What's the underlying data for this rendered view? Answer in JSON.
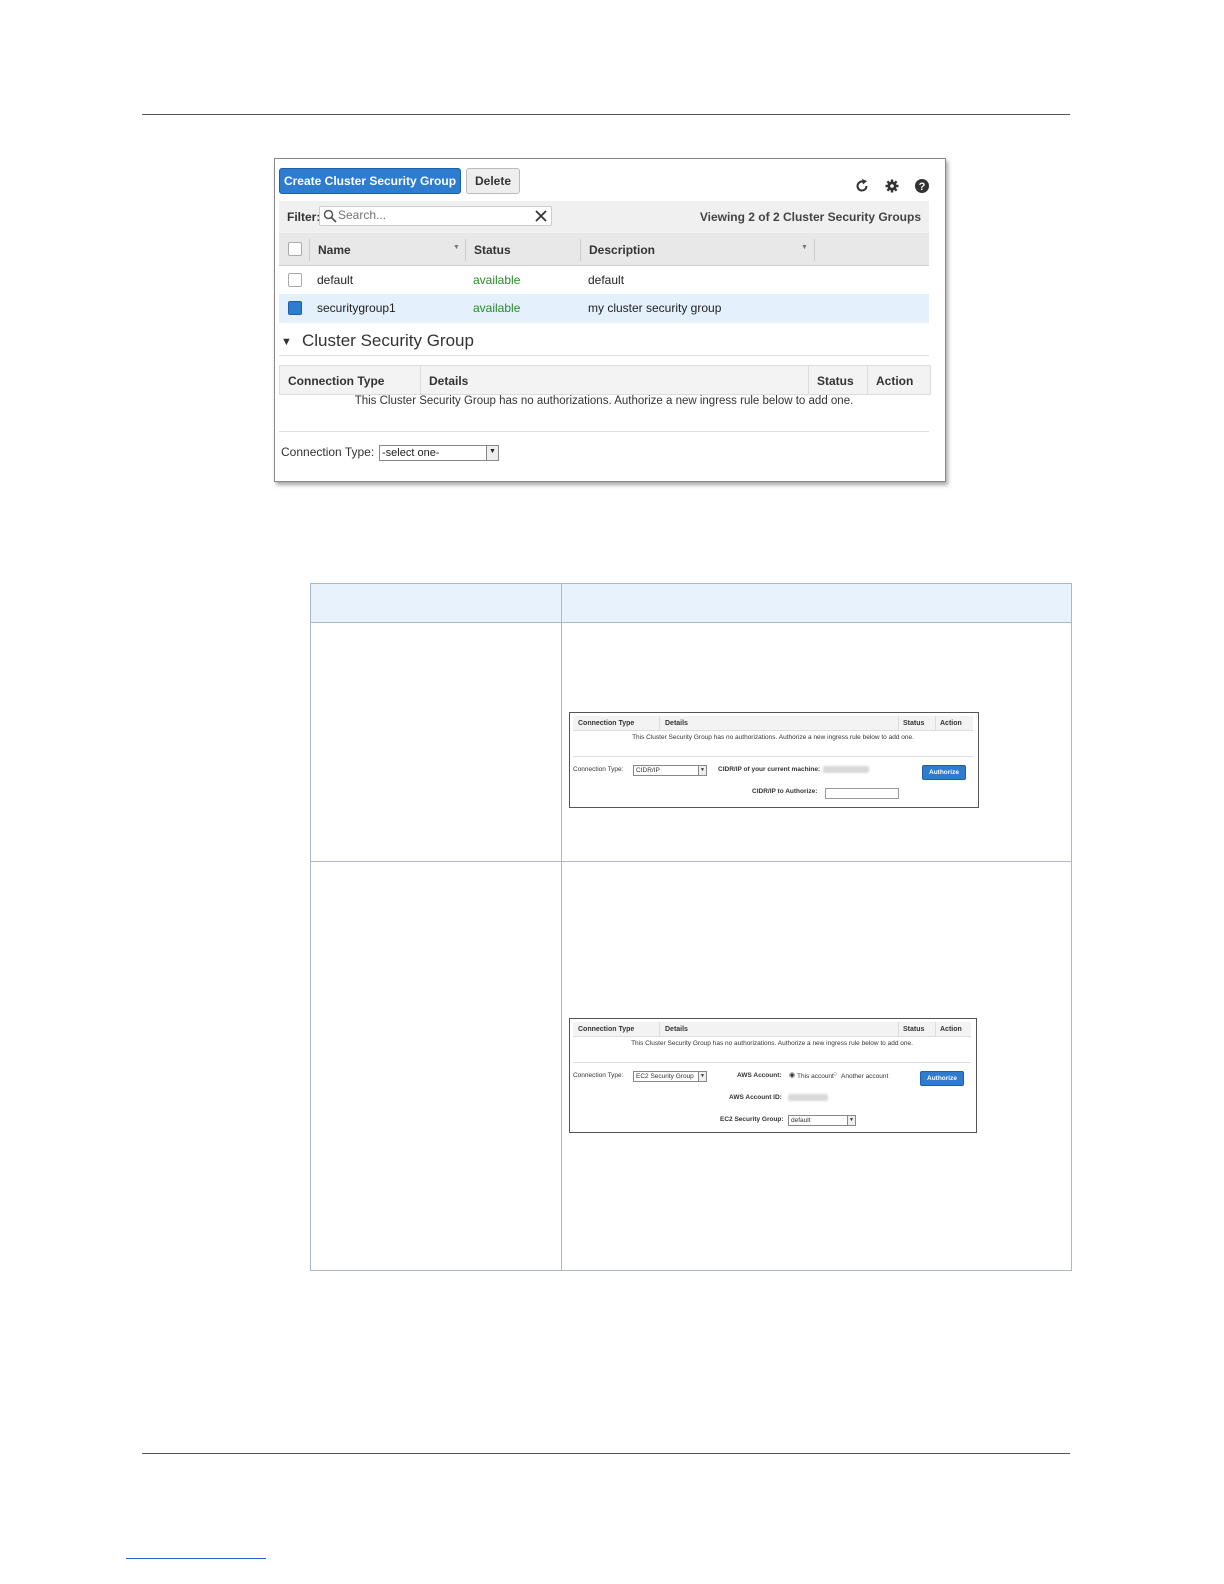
{
  "main_screenshot": {
    "toolbar": {
      "create_label": "Create Cluster Security Group",
      "delete_label": "Delete"
    },
    "filter": {
      "label": "Filter:",
      "search_placeholder": "Search...",
      "viewing_text": "Viewing 2 of 2 Cluster Security Groups"
    },
    "table": {
      "columns": [
        "Name",
        "Status",
        "Description"
      ],
      "rows": [
        {
          "name": "default",
          "status": "available",
          "description": "default",
          "checked": false
        },
        {
          "name": "securitygroup1",
          "status": "available",
          "description": "my cluster security group",
          "checked": true
        }
      ]
    },
    "section": {
      "title": "Cluster Security Group",
      "columns": [
        "Connection Type",
        "Details",
        "Status",
        "Action"
      ],
      "empty_message": "This Cluster Security Group has no authorizations. Authorize a new ingress rule below to add one.",
      "connection_type_label": "Connection Type:",
      "connection_type_value": "-select one-"
    }
  },
  "mini_cidr": {
    "columns": [
      "Connection Type",
      "Details",
      "Status",
      "Action"
    ],
    "empty_message": "This Cluster Security Group has no authorizations. Authorize a new ingress rule below to add one.",
    "connection_type_label": "Connection Type:",
    "connection_type_value": "CIDR/IP",
    "current_machine_label": "CIDR/IP of your current machine:",
    "authorize_label": "CIDR/IP to Authorize:",
    "button": "Authorize"
  },
  "mini_ec2": {
    "columns": [
      "Connection Type",
      "Details",
      "Status",
      "Action"
    ],
    "empty_message": "This Cluster Security Group has no authorizations. Authorize a new ingress rule below to add one.",
    "connection_type_label": "Connection Type:",
    "connection_type_value": "EC2 Security Group",
    "aws_account_label": "AWS Account:",
    "this_account": "This account",
    "another_account": "Another account",
    "aws_account_id_label": "AWS Account ID:",
    "ec2_group_label": "EC2 Security Group:",
    "ec2_group_value": "default",
    "button": "Authorize"
  },
  "colors": {
    "primary_blue": "#2d7cd0",
    "status_green": "#2a8a2a",
    "selected_row": "#e4f0fb",
    "table_header_bg": "#e8f2fc"
  }
}
